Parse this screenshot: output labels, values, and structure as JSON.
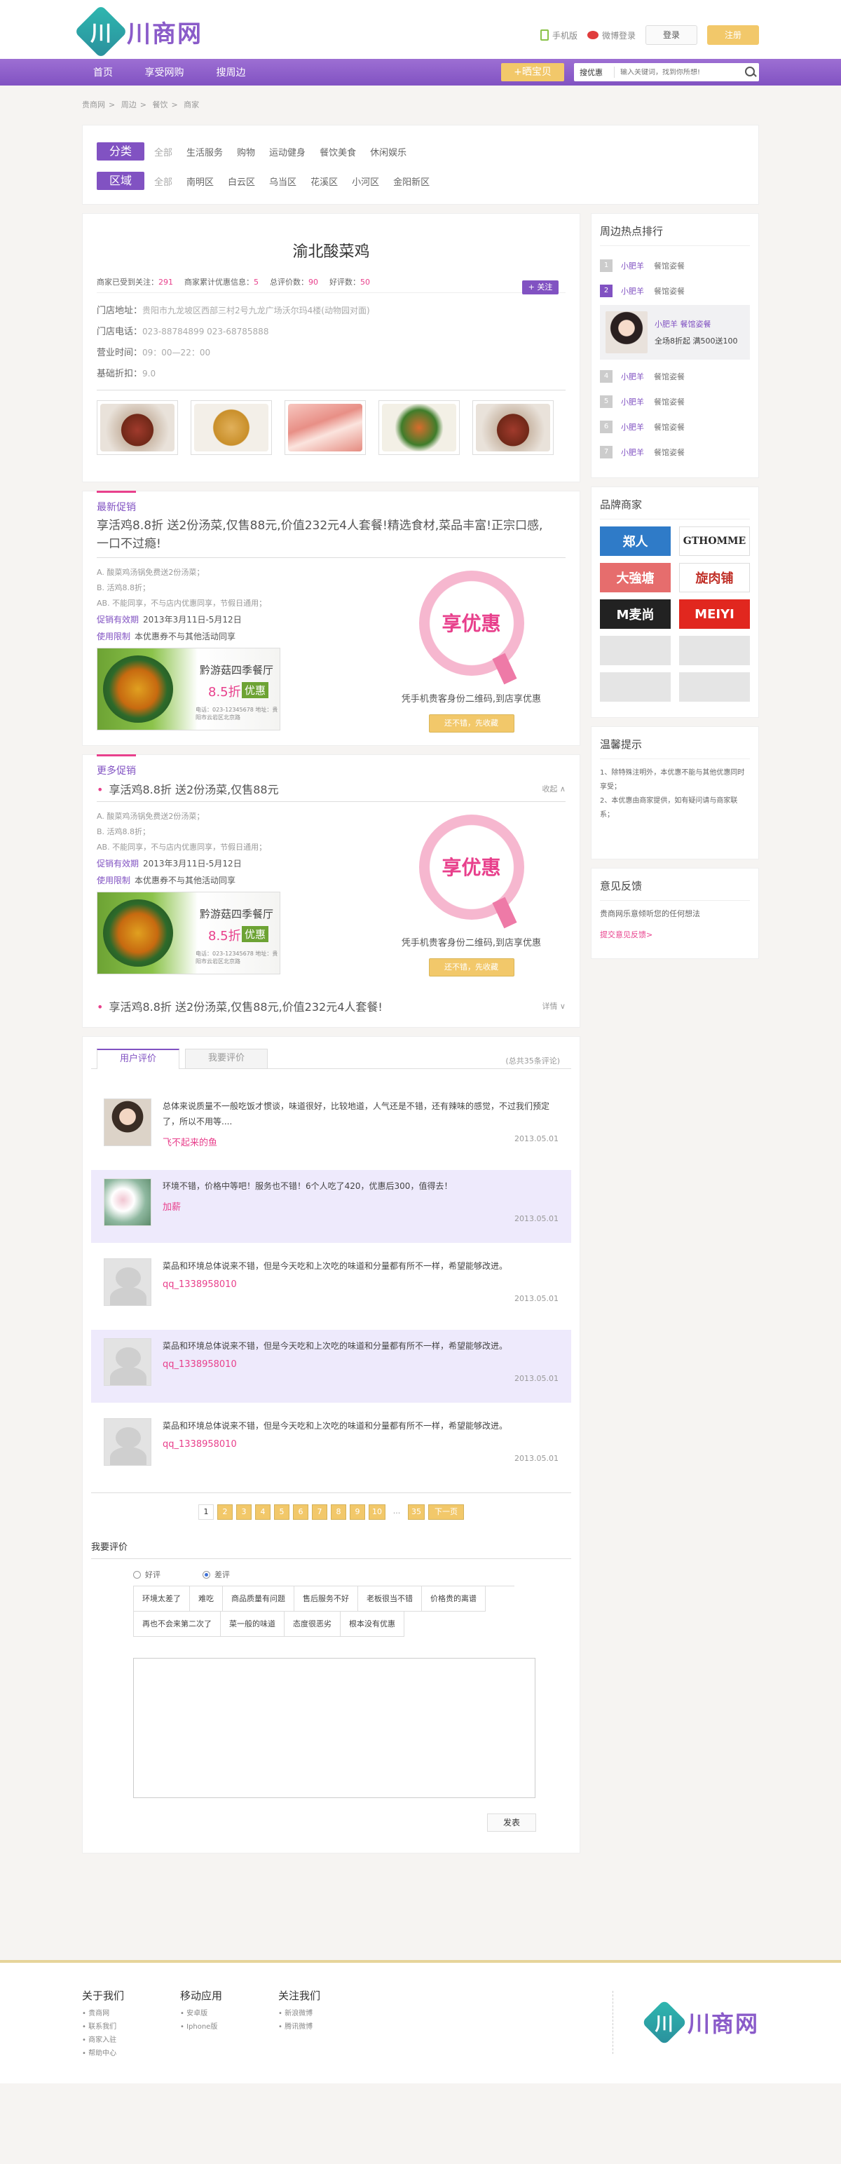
{
  "header": {
    "logo_mark": "川",
    "logo_text": "川商网",
    "mobile_label": "手机版",
    "weibo_label": "微博登录",
    "login_label": "登录",
    "register_label": "注册"
  },
  "nav": {
    "items": [
      "首页",
      "享受网购",
      "搜周边"
    ],
    "shai_label": "+晒宝贝",
    "search_type": "搜优惠",
    "search_placeholder": "输入关键词，找到你所想!"
  },
  "breadcrumb": [
    "贵商网",
    "周边",
    "餐饮",
    "商家"
  ],
  "filter": {
    "category_label": "分类",
    "categories": [
      "全部",
      "生活服务",
      "购物",
      "运动健身",
      "餐饮美食",
      "休闲娱乐"
    ],
    "area_label": "区域",
    "areas": [
      "全部",
      "南明区",
      "白云区",
      "乌当区",
      "花溪区",
      "小河区",
      "金阳新区"
    ]
  },
  "shop": {
    "name": "渝北酸菜鸡",
    "stat1_label": "商家已受到关注：",
    "stat1_value": "291",
    "stat2_label": "商家累计优惠信息：",
    "stat2_value": "5",
    "stat3_label": "总评价数：",
    "stat3_value": "90",
    "stat4_label": "好评数：",
    "stat4_value": "50",
    "follow_label": "+ 关注",
    "address_label": "门店地址：",
    "address": "贵阳市九龙坡区西部三村2号九龙广场沃尔玛4楼(动物园对面)",
    "phone_label": "门店电话：",
    "phone": "023-88784899  023-68785888",
    "hours_label": "营业时间：",
    "hours": "09：00—22：00",
    "discount_label": "基础折扣：",
    "discount": "9.0"
  },
  "promo": {
    "tag": "最新促销",
    "title": "享活鸡8.8折 送2份汤菜,仅售88元,价值232元4人套餐!精选食材,菜品丰富!正宗口感,一口不过瘾!",
    "rules": [
      "A. 酸菜鸡汤锅免费送2份汤菜；",
      "B. 活鸡8.8折；",
      "AB. 不能同享，不与店内优惠同享，节假日通用；"
    ],
    "period_label": "促销有效期",
    "period": "2013年3月11日-5月12日",
    "limit_label": "使用限制",
    "limit": "本优惠券不与其他活动同享",
    "banner_name": "黔游菇四季餐厅",
    "banner_pct": "8.5折",
    "banner_yh": "优惠",
    "banner_small": "电话：023-12345678 地址：贵阳市云岩区北京路",
    "seal_text": "享优惠",
    "caption": "凭手机贵客身份二维码,到店享优惠",
    "collect_label": "还不错，先收藏"
  },
  "more": {
    "tag": "更多促销",
    "title": "享活鸡8.8折 送2份汤菜,仅售88元",
    "collapse_label": "收起 ∧",
    "rules": [
      "A. 酸菜鸡汤锅免费送2份汤菜；",
      "B. 活鸡8.8折；",
      "AB. 不能同享，不与店内优惠同享，节假日通用；"
    ],
    "period_label": "促销有效期",
    "period": "2013年3月11日-5月12日",
    "limit_label": "使用限制",
    "limit": "本优惠券不与其他活动同享",
    "banner_name": "黔游菇四季餐厅",
    "banner_pct": "8.5折",
    "banner_yh": "优惠",
    "banner_small": "电话：023-12345678 地址：贵阳市云岩区北京路",
    "seal_text": "享优惠",
    "caption": "凭手机贵客身份二维码,到店享优惠",
    "collect_label": "还不错，先收藏",
    "foot_title": "享活鸡8.8折 送2份汤菜,仅售88元,价值232元4人套餐!",
    "detail_label": "详情 ∨"
  },
  "reviews": {
    "tab_user": "用户评价",
    "tab_mine": "我要评价",
    "count": "(总共35条评论)",
    "items": [
      {
        "text": "总体来说质量不一般吃饭才惯谈，味道很好，比较地道，人气还是不错，还有辣味的感觉，不过我们预定了，所以不用等....",
        "name": "飞不起来的鱼",
        "date": "2013.05.01"
      },
      {
        "text": "环境不错，价格中等吧！服务也不错！6个人吃了420，优惠后300，值得去！",
        "name": "加薪",
        "date": "2013.05.01"
      },
      {
        "text": "菜品和环境总体说来不错，但是今天吃和上次吃的味道和分量都有所不一样，希望能够改进。",
        "name": "qq_1338958010",
        "date": "2013.05.01"
      },
      {
        "text": "菜品和环境总体说来不错，但是今天吃和上次吃的味道和分量都有所不一样，希望能够改进。",
        "name": "qq_1338958010",
        "date": "2013.05.01"
      },
      {
        "text": "菜品和环境总体说来不错，但是今天吃和上次吃的味道和分量都有所不一样，希望能够改进。",
        "name": "qq_1338958010",
        "date": "2013.05.01"
      }
    ]
  },
  "pager": {
    "pages": [
      "1",
      "2",
      "3",
      "4",
      "5",
      "6",
      "7",
      "8",
      "9",
      "10"
    ],
    "ellipsis": "...",
    "last": "35",
    "next": "下一页"
  },
  "write": {
    "title": "我要评价",
    "good": "好评",
    "bad": "差评",
    "tags": [
      "环境太差了",
      "难吃",
      "商品质量有问题",
      "售后服务不好",
      "老板很当不错",
      "价格贵的离谱",
      "再也不会来第二次了",
      "菜一般的味道",
      "态度很恶劣",
      "根本没有优惠"
    ],
    "submit": "发表"
  },
  "sidebar": {
    "hot_title": "周边热点排行",
    "hot": [
      {
        "rank": "1",
        "name": "小肥羊",
        "cat": "餐馆姿餐"
      },
      {
        "rank": "2",
        "name": "小肥羊",
        "cat": "餐馆姿餐"
      },
      {
        "rank": "4",
        "name": "小肥羊",
        "cat": "餐馆姿餐"
      },
      {
        "rank": "5",
        "name": "小肥羊",
        "cat": "餐馆姿餐"
      },
      {
        "rank": "6",
        "name": "小肥羊",
        "cat": "餐馆姿餐"
      },
      {
        "rank": "7",
        "name": "小肥羊",
        "cat": "餐馆姿餐"
      }
    ],
    "hot_card_title": "小肥羊 餐馆姿餐",
    "hot_card_desc": "全场8折起 满500送100",
    "brands_title": "品牌商家",
    "brands": [
      "郑人",
      "GTHOMME",
      "大強塘",
      "旋肉铺",
      "M麦尚",
      "MEIYI"
    ],
    "tips_title": "温馨提示",
    "tips": [
      "1、除特殊注明外，本优惠不能与其他优惠同时享受；",
      "2、本优惠由商家提供，如有疑问请与商家联系；"
    ],
    "feedback_title": "意见反馈",
    "feedback_text": "贵商网乐意倾听您的任何想法",
    "feedback_link": "提交意见反馈>"
  },
  "footer": {
    "col1_title": "关于我们",
    "col1": [
      "贵商网",
      "联系我们",
      "商家入驻",
      "帮助中心"
    ],
    "col2_title": "移动应用",
    "col2": [
      "安卓版",
      "Iphone版"
    ],
    "col3_title": "关注我们",
    "col3": [
      "新浪微博",
      "腾讯微博"
    ],
    "logo_mark": "川",
    "logo_text": "川商网"
  },
  "colors": {
    "accent": "#8152c2",
    "pink": "#e8408c",
    "gold": "#f2c86a"
  }
}
